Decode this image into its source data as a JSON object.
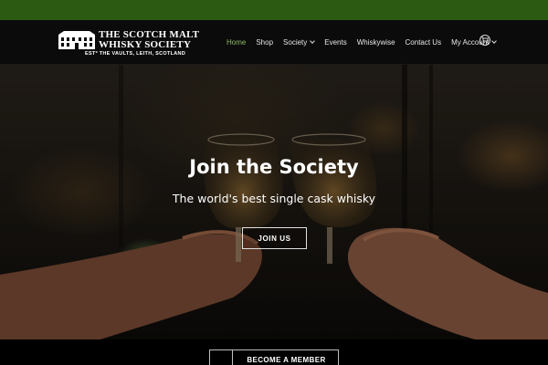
{
  "header": {
    "logo": {
      "line1": "THE SCOTCH MALT",
      "line2": "WHISKY SOCIETY",
      "line3": "ESTº THE VAULTS, LEITH, SCOTLAND"
    },
    "nav": [
      {
        "label": "Home",
        "active": true
      },
      {
        "label": "Shop"
      },
      {
        "label": "Society",
        "dropdown": true
      },
      {
        "label": "Events"
      },
      {
        "label": "Whiskywise"
      },
      {
        "label": "Contact Us"
      },
      {
        "label": "My Account",
        "dropdown": true
      }
    ],
    "cart_icon": "cart-icon"
  },
  "hero": {
    "title": "Join the Society",
    "subtitle": "The world's best single cask whisky",
    "cta": "JOIN US"
  },
  "footer_cta": {
    "label": "BECOME A MEMBER"
  },
  "colors": {
    "top_strip": "#2c5a12",
    "nav_active": "#8dbb64",
    "navbar_bg": "#0b0b0b"
  }
}
